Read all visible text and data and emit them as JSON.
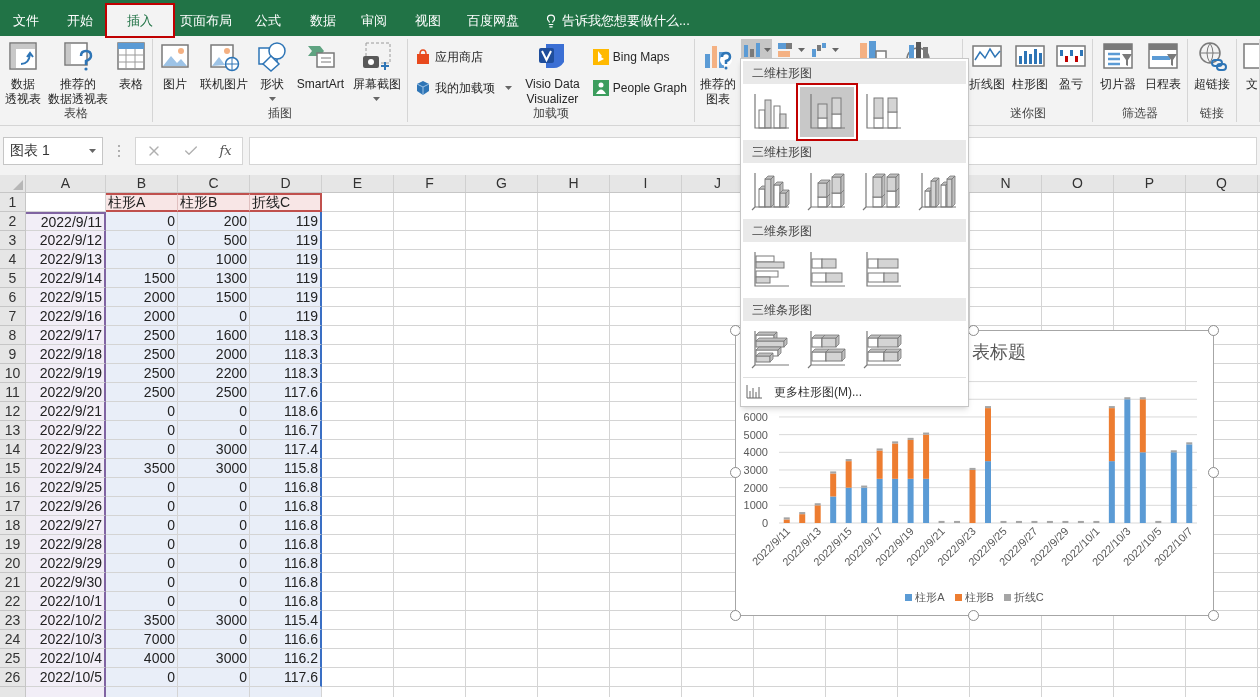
{
  "tabs": [
    {
      "label": "文件",
      "selected": false,
      "outlined": false
    },
    {
      "label": "开始",
      "selected": false,
      "outlined": false
    },
    {
      "label": "插入",
      "selected": true,
      "outlined": true
    },
    {
      "label": "页面布局",
      "selected": false,
      "outlined": false
    },
    {
      "label": "公式",
      "selected": false,
      "outlined": false
    },
    {
      "label": "数据",
      "selected": false,
      "outlined": false
    },
    {
      "label": "审阅",
      "selected": false,
      "outlined": false
    },
    {
      "label": "视图",
      "selected": false,
      "outlined": false
    },
    {
      "label": "百度网盘",
      "selected": false,
      "outlined": false
    }
  ],
  "tell_me": {
    "placeholder": "告诉我您想要做什么..."
  },
  "ribbon": {
    "groups": [
      {
        "label": "表格",
        "items": [
          {
            "kind": "large",
            "lines": [
              "数据",
              "透视表"
            ]
          },
          {
            "kind": "large",
            "lines": [
              "推荐的",
              "数据透视表"
            ]
          },
          {
            "kind": "large",
            "lines": [
              "表格"
            ]
          }
        ]
      },
      {
        "label": "插图",
        "items": [
          {
            "kind": "large",
            "lines": [
              "图片"
            ]
          },
          {
            "kind": "large",
            "lines": [
              "联机图片"
            ]
          },
          {
            "kind": "large",
            "lines": [
              "形状"
            ],
            "dropdown": true
          },
          {
            "kind": "large",
            "lines": [
              "SmartArt"
            ]
          },
          {
            "kind": "large",
            "lines": [
              "屏幕截图"
            ],
            "dropdown": true
          }
        ]
      },
      {
        "label": "加载项",
        "items": [
          {
            "kind": "stack",
            "buttons": [
              {
                "label": "应用商店",
                "dropdown": false
              },
              {
                "label": "我的加载项",
                "dropdown": true
              }
            ]
          },
          {
            "kind": "large",
            "lines": [
              "Visio Data",
              "Visualizer"
            ]
          },
          {
            "kind": "stack",
            "buttons": [
              {
                "label": "Bing Maps",
                "dropdown": false
              },
              {
                "label": "People Graph",
                "dropdown": false
              }
            ]
          }
        ]
      },
      {
        "items": [
          {
            "kind": "large",
            "lines": [
              "推荐的",
              "图表"
            ]
          },
          {
            "kind": "chart-buttons",
            "buttons": [
              {
                "pressed": true
              },
              {
                "pressed": false
              },
              {
                "pressed": false
              }
            ]
          },
          {
            "kind": "icon-only"
          },
          {
            "kind": "icon-only"
          }
        ]
      },
      {
        "label": "迷你图",
        "items": [
          {
            "kind": "large",
            "lines": [
              "折线图"
            ]
          },
          {
            "kind": "large",
            "lines": [
              "柱形图"
            ]
          },
          {
            "kind": "large",
            "lines": [
              "盈亏"
            ]
          }
        ]
      },
      {
        "label": "筛选器",
        "items": [
          {
            "kind": "large",
            "lines": [
              "切片器"
            ]
          },
          {
            "kind": "large",
            "lines": [
              "日程表"
            ]
          }
        ]
      },
      {
        "label": "链接",
        "items": [
          {
            "kind": "large",
            "lines": [
              "超链接"
            ]
          }
        ]
      },
      {
        "items": [
          {
            "kind": "large",
            "lines": [
              "文"
            ]
          }
        ]
      }
    ]
  },
  "formula_bar": {
    "name_box": "图表 1",
    "function_label": "fx"
  },
  "sheet": {
    "columns_left": [
      {
        "label": "A",
        "kind": "category"
      },
      {
        "label": "B",
        "kind": "series"
      },
      {
        "label": "C",
        "kind": "series"
      },
      {
        "label": "D",
        "kind": "series"
      },
      {
        "label": "E",
        "kind": "empty"
      },
      {
        "label": "F",
        "kind": "empty"
      },
      {
        "label": "G",
        "kind": "empty"
      },
      {
        "label": "H",
        "kind": "empty"
      },
      {
        "label": "I",
        "kind": "empty"
      },
      {
        "label": "J",
        "kind": "empty"
      }
    ],
    "columns_right": [
      {
        "label": "N"
      },
      {
        "label": "O"
      },
      {
        "label": "P"
      },
      {
        "label": "Q"
      }
    ],
    "header_row": {
      "number": "1",
      "cells": [
        "柱形A",
        "柱形B",
        "折线C"
      ]
    },
    "rows": [
      {
        "number": "2",
        "date": "2022/9/11",
        "values": [
          "0",
          "200",
          "119"
        ]
      },
      {
        "number": "3",
        "date": "2022/9/12",
        "values": [
          "0",
          "500",
          "119"
        ]
      },
      {
        "number": "4",
        "date": "2022/9/13",
        "values": [
          "0",
          "1000",
          "119"
        ]
      },
      {
        "number": "5",
        "date": "2022/9/14",
        "values": [
          "1500",
          "1300",
          "119"
        ]
      },
      {
        "number": "6",
        "date": "2022/9/15",
        "values": [
          "2000",
          "1500",
          "119"
        ]
      },
      {
        "number": "7",
        "date": "2022/9/16",
        "values": [
          "2000",
          "0",
          "119"
        ]
      },
      {
        "number": "8",
        "date": "2022/9/17",
        "values": [
          "2500",
          "1600",
          "118.3"
        ]
      },
      {
        "number": "9",
        "date": "2022/9/18",
        "values": [
          "2500",
          "2000",
          "118.3"
        ]
      },
      {
        "number": "10",
        "date": "2022/9/19",
        "values": [
          "2500",
          "2200",
          "118.3"
        ]
      },
      {
        "number": "11",
        "date": "2022/9/20",
        "values": [
          "2500",
          "2500",
          "117.6"
        ]
      },
      {
        "number": "12",
        "date": "2022/9/21",
        "values": [
          "0",
          "0",
          "118.6"
        ]
      },
      {
        "number": "13",
        "date": "2022/9/22",
        "values": [
          "0",
          "0",
          "116.7"
        ]
      },
      {
        "number": "14",
        "date": "2022/9/23",
        "values": [
          "0",
          "3000",
          "117.4"
        ]
      },
      {
        "number": "15",
        "date": "2022/9/24",
        "values": [
          "3500",
          "3000",
          "115.8"
        ]
      },
      {
        "number": "16",
        "date": "2022/9/25",
        "values": [
          "0",
          "0",
          "116.8"
        ]
      },
      {
        "number": "17",
        "date": "2022/9/26",
        "values": [
          "0",
          "0",
          "116.8"
        ]
      },
      {
        "number": "18",
        "date": "2022/9/27",
        "values": [
          "0",
          "0",
          "116.8"
        ]
      },
      {
        "number": "19",
        "date": "2022/9/28",
        "values": [
          "0",
          "0",
          "116.8"
        ]
      },
      {
        "number": "20",
        "date": "2022/9/29",
        "values": [
          "0",
          "0",
          "116.8"
        ]
      },
      {
        "number": "21",
        "date": "2022/9/30",
        "values": [
          "0",
          "0",
          "116.8"
        ]
      },
      {
        "number": "22",
        "date": "2022/10/1",
        "values": [
          "0",
          "0",
          "116.8"
        ]
      },
      {
        "number": "23",
        "date": "2022/10/2",
        "values": [
          "3500",
          "3000",
          "115.4"
        ]
      },
      {
        "number": "24",
        "date": "2022/10/3",
        "values": [
          "7000",
          "0",
          "116.6"
        ]
      },
      {
        "number": "25",
        "date": "2022/10/4",
        "values": [
          "4000",
          "3000",
          "116.2"
        ]
      },
      {
        "number": "26",
        "date": "2022/10/5",
        "values": [
          "0",
          "0",
          "117.6"
        ]
      }
    ]
  },
  "chart": {
    "title": "表标题",
    "chart_data": {
      "type": "bar",
      "stacked": true,
      "orientation": "vertical",
      "categories": [
        "2022/9/11",
        null,
        "2022/9/13",
        null,
        "2022/9/15",
        null,
        "2022/9/17",
        null,
        "2022/9/19",
        null,
        "2022/9/21",
        null,
        "2022/9/23",
        null,
        "2022/9/25",
        null,
        "2022/9/27",
        null,
        "2022/9/29",
        null,
        "2022/10/1",
        null,
        "2022/10/3",
        null,
        "2022/10/5",
        null,
        "2022/10/7"
      ],
      "grid": true,
      "series": [
        {
          "name": "柱形A",
          "color": "#5b9bd5",
          "values": [
            0,
            0,
            0,
            1500,
            2000,
            2000,
            2500,
            2500,
            2500,
            2500,
            0,
            0,
            0,
            3500,
            0,
            0,
            0,
            0,
            0,
            0,
            0,
            3500,
            7000,
            4000,
            0,
            4000,
            4450
          ]
        },
        {
          "name": "柱形B",
          "color": "#ed7d31",
          "values": [
            200,
            500,
            1000,
            1300,
            1500,
            0,
            1600,
            2000,
            2200,
            2500,
            0,
            0,
            3000,
            3000,
            0,
            0,
            0,
            0,
            0,
            0,
            0,
            3000,
            0,
            3000,
            0,
            0,
            0
          ]
        },
        {
          "name": "折线C",
          "color": "#a5a5a5",
          "values": [
            119,
            119,
            119,
            119,
            119,
            119,
            118.3,
            118.3,
            118.3,
            117.6,
            118.6,
            116.7,
            117.4,
            115.8,
            116.8,
            116.8,
            116.8,
            116.8,
            116.8,
            116.8,
            116.8,
            115.4,
            116.6,
            116.2,
            117.6,
            115,
            116
          ]
        }
      ],
      "ylim": [
        0,
        8000
      ],
      "yticks": [
        0,
        1000,
        2000,
        3000,
        4000,
        5000,
        6000
      ]
    }
  },
  "gallery": {
    "sections": [
      {
        "title": "二维柱形图",
        "kind": "column",
        "items": [
          {
            "kind": "clustered",
            "selected": false,
            "outlined": false
          },
          {
            "kind": "stacked",
            "selected": true,
            "outlined": true
          },
          {
            "kind": "percent",
            "selected": false,
            "outlined": false
          }
        ]
      },
      {
        "title": "三维柱形图",
        "kind": "column-3d",
        "items": [
          {
            "kind": "clustered",
            "selected": false,
            "outlined": false
          },
          {
            "kind": "stacked",
            "selected": false,
            "outlined": false
          },
          {
            "kind": "percent",
            "selected": false,
            "outlined": false
          },
          {
            "kind": "deep",
            "selected": false,
            "outlined": false
          }
        ]
      },
      {
        "title": "二维条形图",
        "kind": "bar",
        "items": [
          {
            "kind": "clustered",
            "selected": false,
            "outlined": false
          },
          {
            "kind": "stacked",
            "selected": false,
            "outlined": false
          },
          {
            "kind": "percent",
            "selected": false,
            "outlined": false
          }
        ]
      },
      {
        "title": "三维条形图",
        "kind": "bar-3d",
        "items": [
          {
            "kind": "clustered",
            "selected": false,
            "outlined": false
          },
          {
            "kind": "stacked",
            "selected": false,
            "outlined": false
          },
          {
            "kind": "percent",
            "selected": false,
            "outlined": false
          }
        ]
      }
    ],
    "more": "更多柱形图(M)..."
  }
}
